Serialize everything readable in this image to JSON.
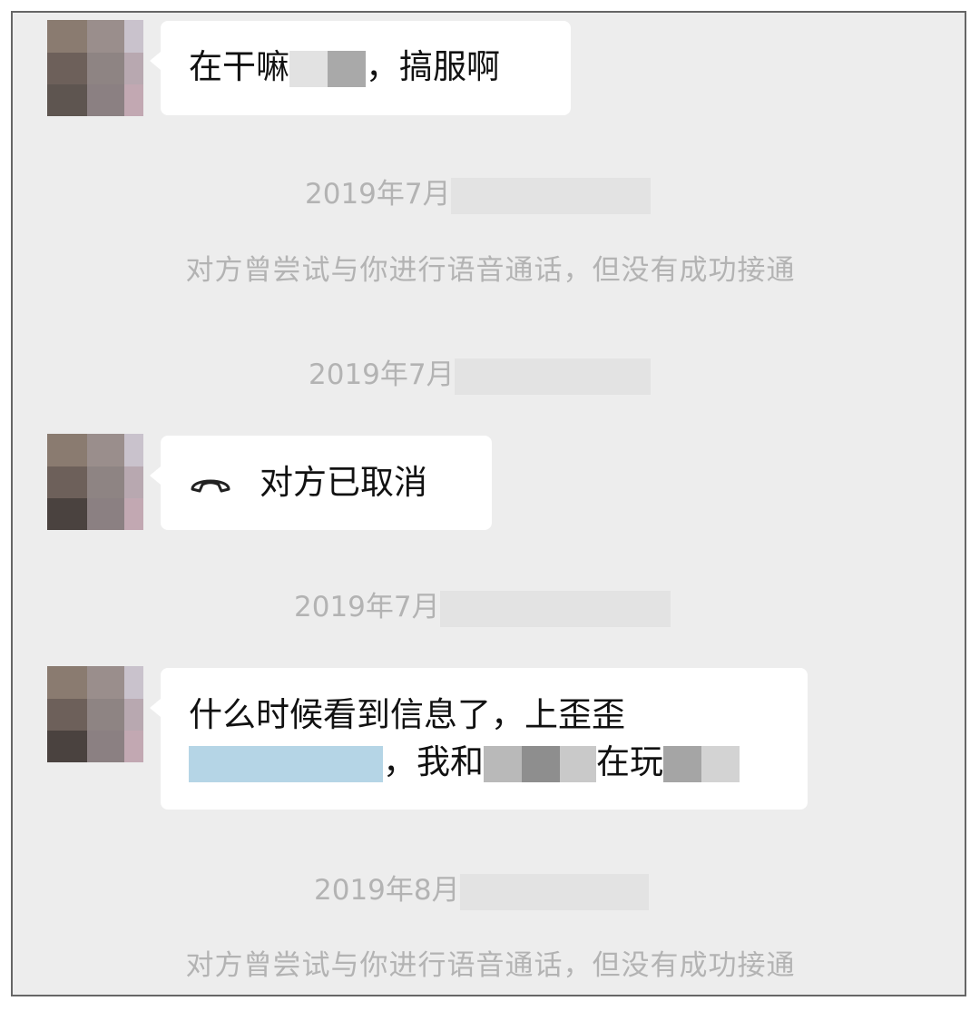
{
  "messages": [
    {
      "text_before": "在干嘛",
      "text_after": "，搞服啊"
    },
    {
      "call_status": "对方已取消",
      "icon": "hangup-phone-icon"
    },
    {
      "line1": "什么时候看到信息了，上歪歪",
      "line2_sep": "，我和",
      "line2_mid": "在玩"
    }
  ],
  "timestamps": [
    {
      "visible": "2019年7月"
    },
    {
      "visible": "2019年7月"
    },
    {
      "visible": "2019年7月"
    },
    {
      "visible": "2019年8月"
    }
  ],
  "system_notices": [
    "对方曾尝试与你进行语音通话，但没有成功接通",
    "对方曾尝试与你进行语音通话，但没有成功接通"
  ],
  "colors": {
    "background": "#ededed",
    "bubble": "#ffffff",
    "meta_text": "#b3b3b3",
    "mosaic_blue": "#b5d5e6"
  }
}
